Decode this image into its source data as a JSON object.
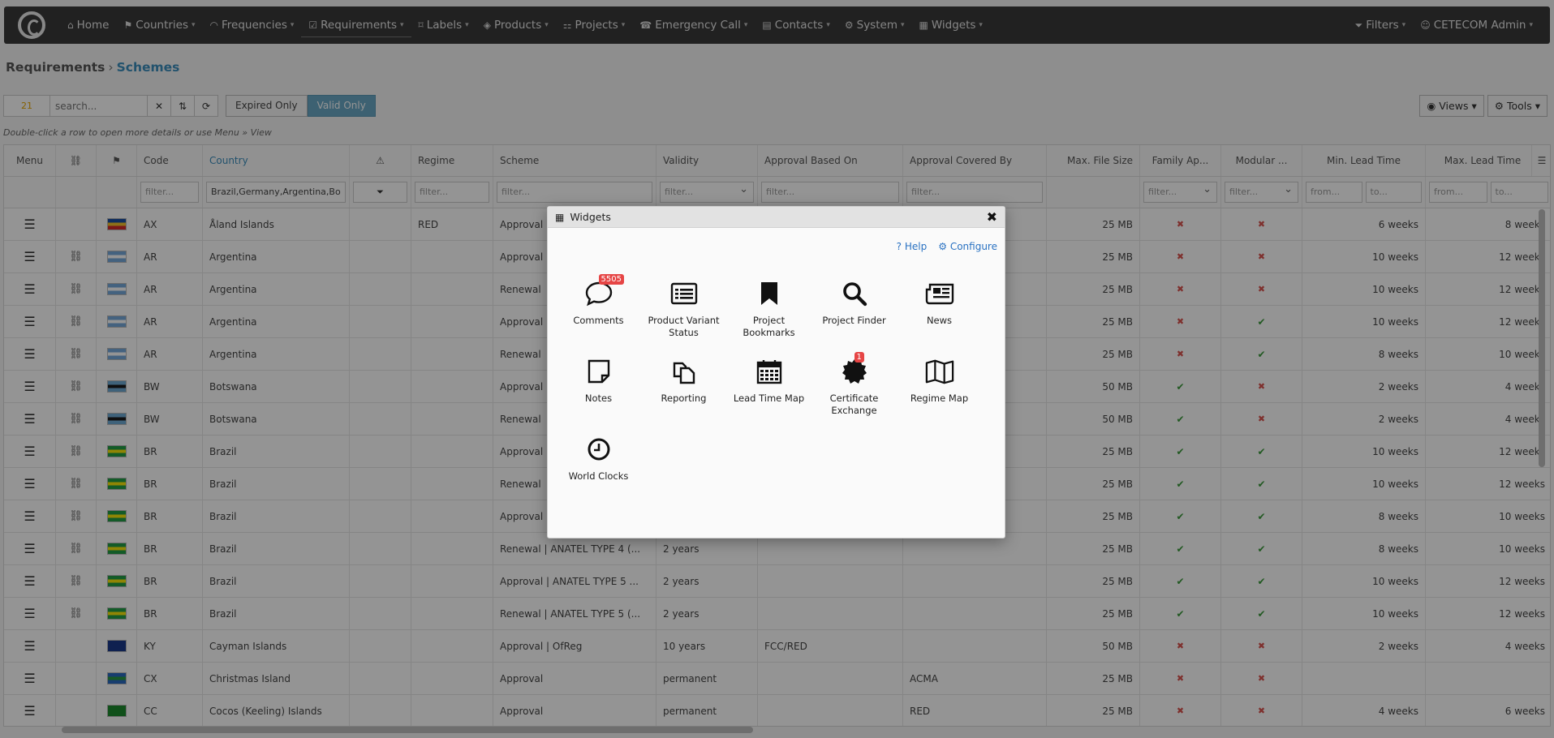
{
  "nav": {
    "items": [
      {
        "label": "Home",
        "icon": "home-icon",
        "glyph": "⌂",
        "caret": false
      },
      {
        "label": "Countries",
        "icon": "flag-icon",
        "glyph": "⚑",
        "caret": true
      },
      {
        "label": "Frequencies",
        "icon": "wifi-icon",
        "glyph": "◠",
        "caret": true
      },
      {
        "label": "Requirements",
        "icon": "checklist-icon",
        "glyph": "☑",
        "caret": true
      },
      {
        "label": "Labels",
        "icon": "tag-icon",
        "glyph": "⌑",
        "caret": true
      },
      {
        "label": "Products",
        "icon": "cube-icon",
        "glyph": "◈",
        "caret": true
      },
      {
        "label": "Projects",
        "icon": "sitemap-icon",
        "glyph": "⚏",
        "caret": true
      },
      {
        "label": "Emergency Call",
        "icon": "phone-icon",
        "glyph": "☎",
        "caret": true
      },
      {
        "label": "Contacts",
        "icon": "addressbook-icon",
        "glyph": "▤",
        "caret": true
      },
      {
        "label": "System",
        "icon": "gears-icon",
        "glyph": "⚙",
        "caret": true
      },
      {
        "label": "Widgets",
        "icon": "grid-icon",
        "glyph": "▦",
        "caret": true
      }
    ],
    "filters_label": "Filters",
    "user_label": "CETECOM Admin"
  },
  "breadcrumb": {
    "parent": "Requirements",
    "current": "Schemes"
  },
  "toolbar": {
    "count": "21",
    "search_placeholder": "search...",
    "expired_label": "Expired Only",
    "valid_label": "Valid Only",
    "views_label": "Views",
    "tools_label": "Tools"
  },
  "hint": "Double-click a row to open more details or use Menu » View",
  "grid": {
    "headers": {
      "menu": "Menu",
      "code": "Code",
      "country": "Country",
      "regime": "Regime",
      "scheme": "Scheme",
      "validity": "Validity",
      "approval_based_on": "Approval Based On",
      "approval_covered_by": "Approval Covered By",
      "max_file_size": "Max. File Size",
      "family": "Family Ap...",
      "modular": "Modular ...",
      "min_lead": "Min. Lead Time",
      "max_lead": "Max. Lead Time"
    },
    "filters": {
      "placeholder": "filter...",
      "country_value": "Brazil,Germany,Argentina,Bo",
      "from": "from...",
      "to": "to..."
    },
    "rows": [
      {
        "link": false,
        "flag": [
          "#1b4fa0",
          "#f3c12c",
          "#d42a2a"
        ],
        "code": "AX",
        "country": "Åland Islands",
        "regime": "RED",
        "scheme": "Approval",
        "validity": "",
        "based": "",
        "covered": "",
        "size": "25 MB",
        "family": "x",
        "modular": "x",
        "min": "6 weeks",
        "max": "8 weeks"
      },
      {
        "link": true,
        "flag": [
          "#75aadb",
          "#ffffff",
          "#75aadb"
        ],
        "code": "AR",
        "country": "Argentina",
        "regime": "",
        "scheme": "Approval",
        "validity": "",
        "based": "",
        "covered": "",
        "size": "25 MB",
        "family": "x",
        "modular": "x",
        "min": "10 weeks",
        "max": "12 weeks"
      },
      {
        "link": true,
        "flag": [
          "#75aadb",
          "#ffffff",
          "#75aadb"
        ],
        "code": "AR",
        "country": "Argentina",
        "regime": "",
        "scheme": "Renewal",
        "validity": "",
        "based": "",
        "covered": "",
        "size": "25 MB",
        "family": "x",
        "modular": "x",
        "min": "10 weeks",
        "max": "12 weeks"
      },
      {
        "link": true,
        "flag": [
          "#75aadb",
          "#ffffff",
          "#75aadb"
        ],
        "code": "AR",
        "country": "Argentina",
        "regime": "",
        "scheme": "Approval",
        "validity": "",
        "based": "",
        "covered": "",
        "size": "25 MB",
        "family": "x",
        "modular": "check",
        "min": "10 weeks",
        "max": "12 weeks"
      },
      {
        "link": true,
        "flag": [
          "#75aadb",
          "#ffffff",
          "#75aadb"
        ],
        "code": "AR",
        "country": "Argentina",
        "regime": "",
        "scheme": "Renewal",
        "validity": "",
        "based": "",
        "covered": "",
        "size": "25 MB",
        "family": "x",
        "modular": "check",
        "min": "8 weeks",
        "max": "10 weeks"
      },
      {
        "link": true,
        "flag": [
          "#6da9d2",
          "#1a1a1a",
          "#6da9d2"
        ],
        "code": "BW",
        "country": "Botswana",
        "regime": "",
        "scheme": "Approval",
        "validity": "",
        "based": "",
        "covered": "",
        "size": "50 MB",
        "family": "check",
        "modular": "x",
        "min": "2 weeks",
        "max": "4 weeks"
      },
      {
        "link": true,
        "flag": [
          "#6da9d2",
          "#1a1a1a",
          "#6da9d2"
        ],
        "code": "BW",
        "country": "Botswana",
        "regime": "",
        "scheme": "Renewal",
        "validity": "",
        "based": "",
        "covered": "",
        "size": "50 MB",
        "family": "check",
        "modular": "x",
        "min": "2 weeks",
        "max": "4 weeks"
      },
      {
        "link": true,
        "flag": [
          "#229e45",
          "#f8e509",
          "#229e45"
        ],
        "code": "BR",
        "country": "Brazil",
        "regime": "",
        "scheme": "Approval",
        "validity": "",
        "based": "",
        "covered": "",
        "size": "25 MB",
        "family": "check",
        "modular": "check",
        "min": "10 weeks",
        "max": "12 weeks"
      },
      {
        "link": true,
        "flag": [
          "#229e45",
          "#f8e509",
          "#229e45"
        ],
        "code": "BR",
        "country": "Brazil",
        "regime": "",
        "scheme": "Renewal",
        "validity": "",
        "based": "",
        "covered": "",
        "size": "25 MB",
        "family": "check",
        "modular": "check",
        "min": "10 weeks",
        "max": "12 weeks"
      },
      {
        "link": true,
        "flag": [
          "#229e45",
          "#f8e509",
          "#229e45"
        ],
        "code": "BR",
        "country": "Brazil",
        "regime": "",
        "scheme": "Approval",
        "validity": "",
        "based": "",
        "covered": "",
        "size": "25 MB",
        "family": "check",
        "modular": "check",
        "min": "8 weeks",
        "max": "10 weeks"
      },
      {
        "link": true,
        "flag": [
          "#229e45",
          "#f8e509",
          "#229e45"
        ],
        "code": "BR",
        "country": "Brazil",
        "regime": "",
        "scheme": "Renewal | ANATEL TYPE 4 (...",
        "validity": "2 years",
        "based": "",
        "covered": "",
        "size": "25 MB",
        "family": "check",
        "modular": "check",
        "min": "8 weeks",
        "max": "10 weeks"
      },
      {
        "link": true,
        "flag": [
          "#229e45",
          "#f8e509",
          "#229e45"
        ],
        "code": "BR",
        "country": "Brazil",
        "regime": "",
        "scheme": "Approval | ANATEL TYPE 5 ...",
        "validity": "2 years",
        "based": "",
        "covered": "",
        "size": "25 MB",
        "family": "check",
        "modular": "check",
        "min": "10 weeks",
        "max": "12 weeks"
      },
      {
        "link": true,
        "flag": [
          "#229e45",
          "#f8e509",
          "#229e45"
        ],
        "code": "BR",
        "country": "Brazil",
        "regime": "",
        "scheme": "Renewal | ANATEL TYPE 5 (...",
        "validity": "2 years",
        "based": "",
        "covered": "",
        "size": "25 MB",
        "family": "check",
        "modular": "check",
        "min": "10 weeks",
        "max": "12 weeks"
      },
      {
        "link": false,
        "flag": [
          "#1a3a8a",
          "#1a3a8a",
          "#1a3a8a"
        ],
        "code": "KY",
        "country": "Cayman Islands",
        "regime": "",
        "scheme": "Approval | OfReg",
        "validity": "10 years",
        "based": "FCC/RED",
        "covered": "",
        "size": "50 MB",
        "family": "x",
        "modular": "x",
        "min": "2 weeks",
        "max": "4 weeks"
      },
      {
        "link": false,
        "flag": [
          "#2a6ac0",
          "#2a9a40",
          "#2a6ac0"
        ],
        "code": "CX",
        "country": "Christmas Island",
        "regime": "",
        "scheme": "Approval",
        "validity": "permanent",
        "based": "",
        "covered": "ACMA",
        "size": "25 MB",
        "family": "x",
        "modular": "x",
        "min": "",
        "max": ""
      },
      {
        "link": false,
        "flag": [
          "#1c8a2e",
          "#1c8a2e",
          "#1c8a2e"
        ],
        "code": "CC",
        "country": "Cocos (Keeling) Islands",
        "regime": "",
        "scheme": "Approval",
        "validity": "permanent",
        "based": "",
        "covered": "RED",
        "size": "25 MB",
        "family": "x",
        "modular": "x",
        "min": "4 weeks",
        "max": "6 weeks"
      }
    ]
  },
  "modal": {
    "title": "Widgets",
    "help_label": "Help",
    "configure_label": "Configure",
    "widgets": [
      {
        "label": "Comments",
        "icon": "comments-icon",
        "badge": "5505"
      },
      {
        "label": "Product Variant Status",
        "icon": "list-icon",
        "badge": ""
      },
      {
        "label": "Project Bookmarks",
        "icon": "bookmark-icon",
        "badge": ""
      },
      {
        "label": "Project Finder",
        "icon": "search-icon",
        "badge": ""
      },
      {
        "label": "News",
        "icon": "newspaper-icon",
        "badge": ""
      },
      {
        "label": "Notes",
        "icon": "note-icon",
        "badge": ""
      },
      {
        "label": "Reporting",
        "icon": "copy-icon",
        "badge": ""
      },
      {
        "label": "Lead Time Map",
        "icon": "calendar-icon",
        "badge": ""
      },
      {
        "label": "Certificate Exchange",
        "icon": "certificate-icon",
        "badge": "1"
      },
      {
        "label": "Regime Map",
        "icon": "map-icon",
        "badge": ""
      },
      {
        "label": "World Clocks",
        "icon": "clock-icon",
        "badge": ""
      }
    ]
  }
}
